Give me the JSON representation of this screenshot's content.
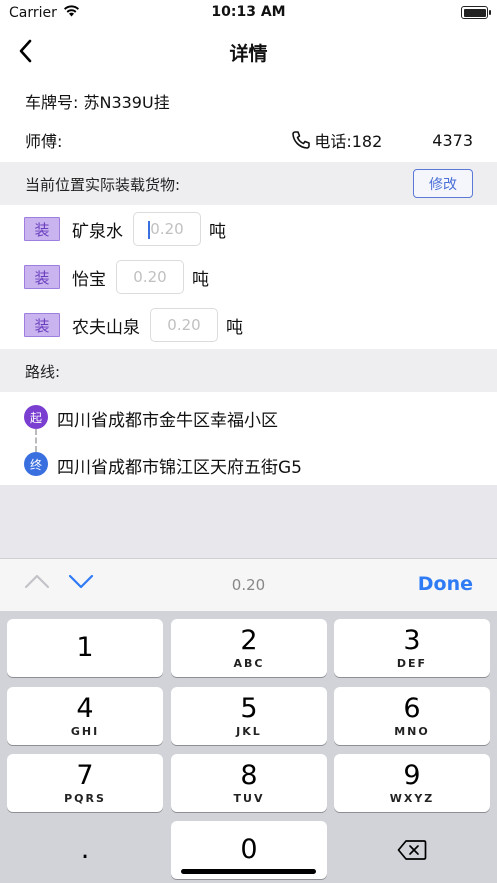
{
  "status": {
    "carrier": "Carrier",
    "time": "10:13 AM"
  },
  "nav": {
    "title": "详情"
  },
  "info": {
    "plate": "车牌号: 苏N339U挂",
    "master": "师傅:",
    "phone_label": "电话:182",
    "phone_tail": "4373"
  },
  "goods_section": {
    "label": "当前位置实际装载货物:",
    "edit_label": "修改"
  },
  "goods": [
    {
      "badge": "装",
      "name": "矿泉水",
      "qty_placeholder": "0.20",
      "unit": "吨",
      "active": true
    },
    {
      "badge": "装",
      "name": "怡宝",
      "qty_placeholder": "0.20",
      "unit": "吨",
      "active": false
    },
    {
      "badge": "装",
      "name": "农夫山泉",
      "qty_placeholder": "0.20",
      "unit": "吨",
      "active": false
    }
  ],
  "route_section": {
    "label": "路线:"
  },
  "route": {
    "start_badge": "起",
    "start": "四川省成都市金牛区幸福小区",
    "end_badge": "终",
    "end": "四川省成都市锦江区天府五街G5"
  },
  "keyboard": {
    "accessory_value": "0.20",
    "done_label": "Done",
    "keys": [
      {
        "num": "1",
        "letters": ""
      },
      {
        "num": "2",
        "letters": "ABC"
      },
      {
        "num": "3",
        "letters": "DEF"
      },
      {
        "num": "4",
        "letters": "GHI"
      },
      {
        "num": "5",
        "letters": "JKL"
      },
      {
        "num": "6",
        "letters": "MNO"
      },
      {
        "num": "7",
        "letters": "PQRS"
      },
      {
        "num": "8",
        "letters": "TUV"
      },
      {
        "num": "9",
        "letters": "WXYZ"
      },
      {
        "num": "0",
        "letters": ""
      }
    ],
    "decimal": "."
  },
  "colors": {
    "accent": "#2f7bf5",
    "badge_bg": "#c9b4ef",
    "start_dot": "#7a3fd0",
    "end_dot": "#3a6fe0"
  }
}
